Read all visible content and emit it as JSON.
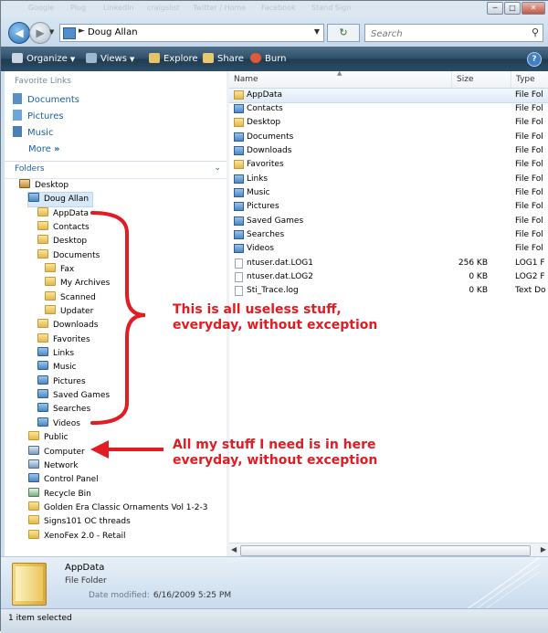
{
  "browser_ghost_tabs": [
    "Google",
    "Plug",
    "LinkedIn",
    "craigslist",
    "Twitter / Home",
    "Facebook",
    "Stand Sign",
    "Sign in to the program to finally finish"
  ],
  "window": {
    "minimize": "─",
    "maximize": "□",
    "close": "✕"
  },
  "address": {
    "back_icon": "back-arrow-icon",
    "forward_icon": "forward-arrow-icon",
    "path": "Doug Allan",
    "search_placeholder": "Search"
  },
  "commandbar": {
    "organize": "Organize",
    "views": "Views",
    "explore": "Explore",
    "share": "Share",
    "burn": "Burn",
    "help": "?"
  },
  "favorites": {
    "title": "Favorite Links",
    "items": [
      "Documents",
      "Pictures",
      "Music"
    ],
    "more": "More",
    "more_suffix": "»"
  },
  "folders": {
    "title": "Folders",
    "tree": [
      {
        "label": "Desktop",
        "icon": "desktop"
      },
      {
        "label": "Doug Allan",
        "icon": "user"
      },
      {
        "label": "AppData",
        "icon": "folder"
      },
      {
        "label": "Contacts",
        "icon": "folder"
      },
      {
        "label": "Desktop",
        "icon": "folder"
      },
      {
        "label": "Documents",
        "icon": "folder"
      },
      {
        "label": "Fax",
        "icon": "folder"
      },
      {
        "label": "My Archives",
        "icon": "folder"
      },
      {
        "label": "Scanned",
        "icon": "folder"
      },
      {
        "label": "Updater",
        "icon": "folder"
      },
      {
        "label": "Downloads",
        "icon": "folder"
      },
      {
        "label": "Favorites",
        "icon": "folder"
      },
      {
        "label": "Links",
        "icon": "folder"
      },
      {
        "label": "Music",
        "icon": "folder"
      },
      {
        "label": "Pictures",
        "icon": "folder"
      },
      {
        "label": "Saved Games",
        "icon": "folder"
      },
      {
        "label": "Searches",
        "icon": "folder"
      },
      {
        "label": "Videos",
        "icon": "folder"
      },
      {
        "label": "Public",
        "icon": "folder"
      },
      {
        "label": "Computer",
        "icon": "computer"
      },
      {
        "label": "Network",
        "icon": "network"
      },
      {
        "label": "Control Panel",
        "icon": "control"
      },
      {
        "label": "Recycle Bin",
        "icon": "bin"
      },
      {
        "label": "Golden Era Classic Ornaments Vol 1-2-3",
        "icon": "folder"
      },
      {
        "label": "Signs101 OC threads",
        "icon": "folder"
      },
      {
        "label": "XenoFex 2.0 - Retail",
        "icon": "folder"
      }
    ]
  },
  "list": {
    "columns": {
      "name": "Name",
      "size": "Size",
      "type": "Type"
    },
    "rows": [
      {
        "name": "AppData",
        "size": "",
        "type": "File Fol",
        "icon": "folder"
      },
      {
        "name": "Contacts",
        "size": "",
        "type": "File Fol",
        "icon": "folder"
      },
      {
        "name": "Desktop",
        "size": "",
        "type": "File Fol",
        "icon": "folder"
      },
      {
        "name": "Documents",
        "size": "",
        "type": "File Fol",
        "icon": "folder"
      },
      {
        "name": "Downloads",
        "size": "",
        "type": "File Fol",
        "icon": "folder"
      },
      {
        "name": "Favorites",
        "size": "",
        "type": "File Fol",
        "icon": "folder"
      },
      {
        "name": "Links",
        "size": "",
        "type": "File Fol",
        "icon": "folder"
      },
      {
        "name": "Music",
        "size": "",
        "type": "File Fol",
        "icon": "folder"
      },
      {
        "name": "Pictures",
        "size": "",
        "type": "File Fol",
        "icon": "folder"
      },
      {
        "name": "Saved Games",
        "size": "",
        "type": "File Fol",
        "icon": "folder"
      },
      {
        "name": "Searches",
        "size": "",
        "type": "File Fol",
        "icon": "folder"
      },
      {
        "name": "Videos",
        "size": "",
        "type": "File Fol",
        "icon": "folder"
      },
      {
        "name": "ntuser.dat.LOG1",
        "size": "256 KB",
        "type": "LOG1 F",
        "icon": "file"
      },
      {
        "name": "ntuser.dat.LOG2",
        "size": "0 KB",
        "type": "LOG2 F",
        "icon": "file"
      },
      {
        "name": "Sti_Trace.log",
        "size": "0 KB",
        "type": "Text Do",
        "icon": "file"
      }
    ]
  },
  "details": {
    "name": "AppData",
    "type": "File Folder",
    "modified_label": "Date modified:",
    "modified_value": "6/16/2009 5:25 PM"
  },
  "status": {
    "text": "1 item selected"
  },
  "annotations": {
    "useless_line1": "This is all useless stuff,",
    "useless_line2": "everyday, without exception",
    "needed_line1": "All my stuff I need is in here",
    "needed_line2": "everyday, without exception",
    "color": "#e31b23"
  }
}
